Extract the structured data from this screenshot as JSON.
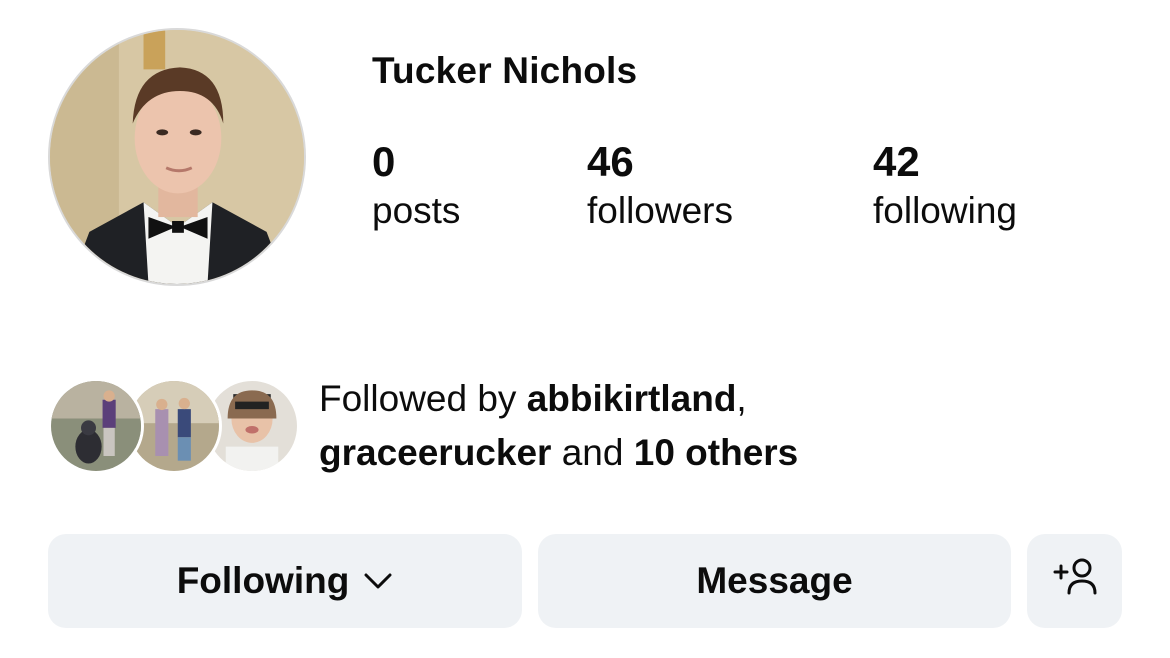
{
  "profile": {
    "name": "Tucker Nichols"
  },
  "stats": {
    "posts": {
      "count": "0",
      "label": "posts"
    },
    "followers": {
      "count": "46",
      "label": "followers"
    },
    "following": {
      "count": "42",
      "label": "following"
    }
  },
  "followed_by": {
    "prefix": "Followed by ",
    "user1": "abbikirtland",
    "sep": ",",
    "user2": "graceerucker",
    "connector": " and ",
    "others": "10 others"
  },
  "actions": {
    "following_label": "Following",
    "message_label": "Message"
  },
  "icons": {
    "chevron": "chevron-down-icon",
    "add_person": "add-person-icon"
  },
  "colors": {
    "button_bg": "#eff2f5",
    "text": "#0c0c0c"
  }
}
